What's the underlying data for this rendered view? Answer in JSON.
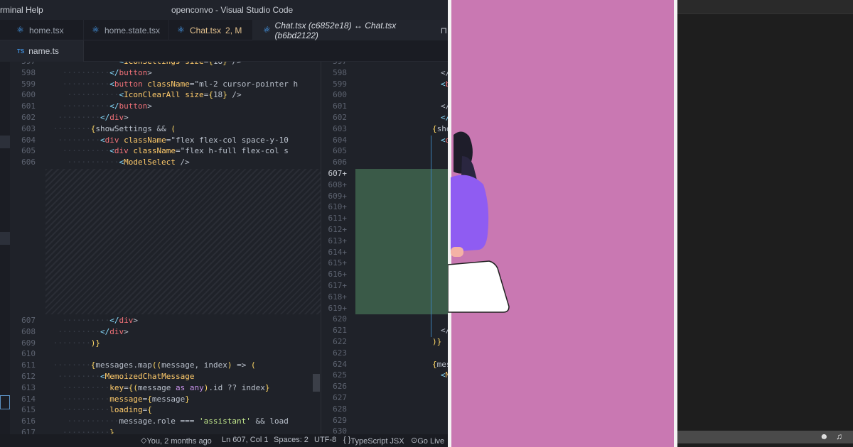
{
  "titlebar": {
    "menu": [
      "rminal",
      "Help"
    ],
    "title": "openconvo - Visual Studio Code"
  },
  "tabs": [
    {
      "label": "home.tsx",
      "icon": "react-icon",
      "modified": ""
    },
    {
      "label": "home.state.tsx",
      "icon": "react-icon",
      "modified": ""
    },
    {
      "label": "Chat.tsx",
      "icon": "react-icon",
      "modified": "2, M"
    },
    {
      "label": "Chat.tsx (c6852e18) ↔ Chat.tsx (b6bd2122)",
      "icon": "react-icon",
      "modified": ""
    }
  ],
  "tabs_row2": [
    {
      "label": "name.ts",
      "badge": "TS"
    }
  ],
  "left_lines": [
    {
      "n": "597",
      "code": "<IconSettings size={18} />"
    },
    {
      "n": "598",
      "code": "</button>"
    },
    {
      "n": "599",
      "code": "<button className=\"ml-2 cursor-pointer h"
    },
    {
      "n": "600",
      "code": "<IconClearAll size={18} />"
    },
    {
      "n": "601",
      "code": "</button>"
    },
    {
      "n": "602",
      "code": "</div>"
    },
    {
      "n": "603",
      "code": "{showSettings && ("
    },
    {
      "n": "604",
      "code": "<div className=\"flex flex-col space-y-10"
    },
    {
      "n": "605",
      "code": "<div className=\"flex h-full flex-col s"
    },
    {
      "n": "606",
      "code": "<ModelSelect />"
    },
    {
      "n": "607",
      "code": "</div>"
    },
    {
      "n": "608",
      "code": "</div>"
    },
    {
      "n": "609",
      "code": ")}"
    },
    {
      "n": "610",
      "code": ""
    },
    {
      "n": "611",
      "code": "{messages.map((message, index) => ("
    },
    {
      "n": "612",
      "code": "<MemoizedChatMessage"
    },
    {
      "n": "613",
      "code": "key={(message as any).id ?? index}"
    },
    {
      "n": "614",
      "code": "message={message}"
    },
    {
      "n": "615",
      "code": "loading={"
    },
    {
      "n": "616",
      "code": "message.role === 'assistant' && load"
    },
    {
      "n": "617",
      "code": "}"
    }
  ],
  "right_lines": [
    {
      "n": "597",
      "code": ""
    },
    {
      "n": "598",
      "code": "</"
    },
    {
      "n": "599",
      "code": "<b"
    },
    {
      "n": "600",
      "code": ""
    },
    {
      "n": "601",
      "code": "</"
    },
    {
      "n": "602",
      "code": "</di"
    },
    {
      "n": "603",
      "code": "{show"
    },
    {
      "n": "604",
      "code": "<d"
    },
    {
      "n": "605",
      "code": ""
    },
    {
      "n": "606",
      "code": ""
    },
    {
      "n": "607+",
      "code": ""
    },
    {
      "n": "608+",
      "code": ""
    },
    {
      "n": "609+",
      "code": ""
    },
    {
      "n": "610+",
      "code": ""
    },
    {
      "n": "611+",
      "code": ""
    },
    {
      "n": "612+",
      "code": ""
    },
    {
      "n": "613+",
      "code": ""
    },
    {
      "n": "614+",
      "code": ""
    },
    {
      "n": "615+",
      "code": ""
    },
    {
      "n": "616+",
      "code": ""
    },
    {
      "n": "617+",
      "code": ""
    },
    {
      "n": "618+",
      "code": ""
    },
    {
      "n": "619+",
      "code": ""
    },
    {
      "n": "620",
      "code": ""
    },
    {
      "n": "621",
      "code": "</"
    },
    {
      "n": "622",
      "code": ")}"
    },
    {
      "n": "623",
      "code": ""
    },
    {
      "n": "624",
      "code": "{mes"
    },
    {
      "n": "625",
      "code": "<M"
    },
    {
      "n": "626",
      "code": ""
    },
    {
      "n": "627",
      "code": ""
    },
    {
      "n": "628",
      "code": ""
    },
    {
      "n": "629",
      "code": ""
    },
    {
      "n": "630",
      "code": ""
    }
  ],
  "statusbar": {
    "blame": "You, 2 months ago",
    "position": "Ln 607, Col 1",
    "spaces": "Spaces: 2",
    "encoding": "UTF-8",
    "language": "TypeScript JSX",
    "golive": "Go Live"
  },
  "colors": {
    "illustration_bg": "#c978b2",
    "added_block": "#3a5a48",
    "figure_shirt": "#8f5cf2"
  }
}
